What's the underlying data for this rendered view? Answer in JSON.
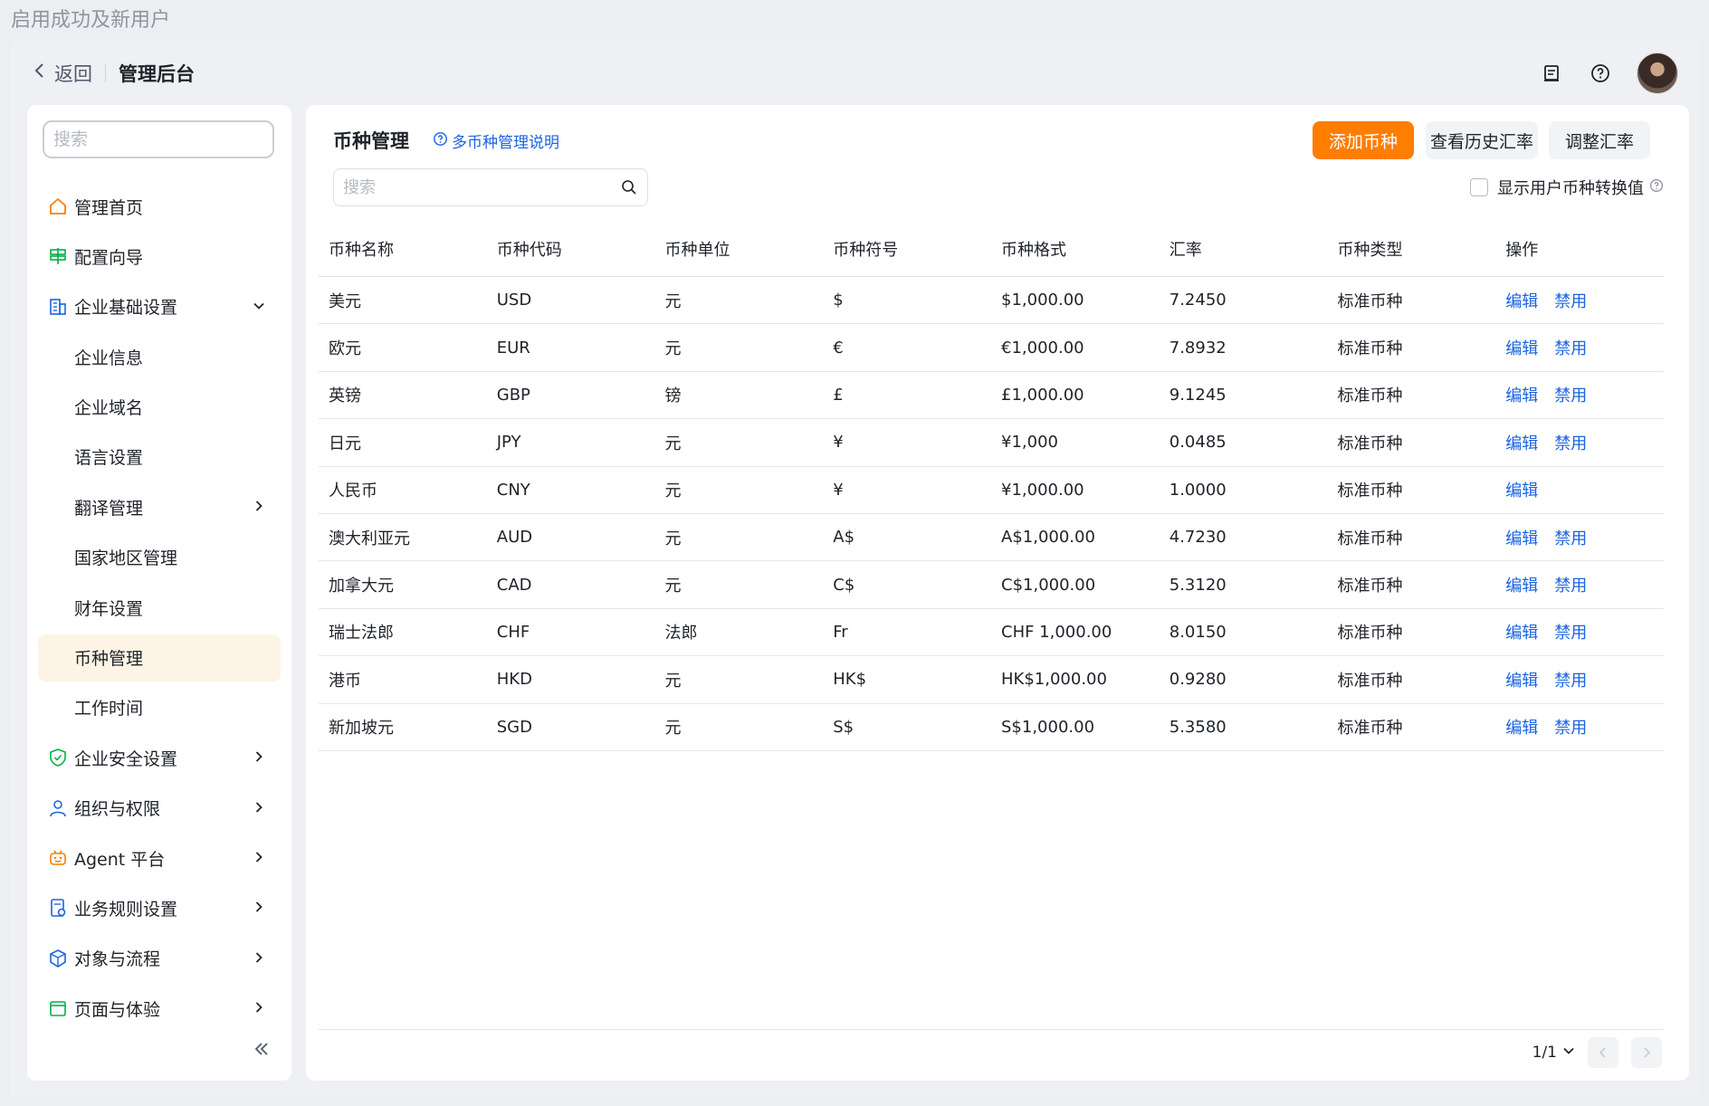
{
  "window": {
    "toast": "启用成功及新用户"
  },
  "header": {
    "back_label": "返回",
    "title": "管理后台",
    "icons": [
      "document-icon",
      "help-circle-icon",
      "avatar"
    ]
  },
  "sidebar": {
    "search_placeholder": "搜索",
    "items": [
      {
        "label": "管理首页",
        "icon": "home-icon",
        "level": 1,
        "arrow": ""
      },
      {
        "label": "配置向导",
        "icon": "signpost-icon",
        "level": 1,
        "arrow": ""
      },
      {
        "label": "企业基础设置",
        "icon": "building-icon",
        "level": 1,
        "arrow": "down"
      },
      {
        "label": "企业信息",
        "level": 2,
        "arrow": ""
      },
      {
        "label": "企业域名",
        "level": 2,
        "arrow": ""
      },
      {
        "label": "语言设置",
        "level": 2,
        "arrow": ""
      },
      {
        "label": "翻译管理",
        "level": 2,
        "arrow": "right"
      },
      {
        "label": "国家地区管理",
        "level": 2,
        "arrow": ""
      },
      {
        "label": "财年设置",
        "level": 2,
        "arrow": ""
      },
      {
        "label": "币种管理",
        "level": 2,
        "arrow": "",
        "active": true
      },
      {
        "label": "工作时间",
        "level": 2,
        "arrow": ""
      },
      {
        "label": "企业安全设置",
        "icon": "shield-icon",
        "level": 1,
        "arrow": "right"
      },
      {
        "label": "组织与权限",
        "icon": "user-icon",
        "level": 1,
        "arrow": "right"
      },
      {
        "label": "Agent 平台",
        "icon": "robot-icon",
        "level": 1,
        "arrow": "right"
      },
      {
        "label": "业务规则设置",
        "icon": "rules-icon",
        "level": 1,
        "arrow": "right"
      },
      {
        "label": "对象与流程",
        "icon": "cube-icon",
        "level": 1,
        "arrow": "right"
      },
      {
        "label": "页面与体验",
        "icon": "window-icon",
        "level": 1,
        "arrow": "right"
      }
    ]
  },
  "main": {
    "title": "币种管理",
    "help_link": "多币种管理说明",
    "buttons": {
      "add": "添加币种",
      "history": "查看历史汇率",
      "adjust": "调整汇率"
    },
    "search_placeholder": "搜索",
    "show_conversion_label": "显示用户币种转换值",
    "columns": [
      "币种名称",
      "币种代码",
      "币种单位",
      "币种符号",
      "币种格式",
      "汇率",
      "币种类型",
      "操作"
    ],
    "edit_label": "编辑",
    "disable_label": "禁用",
    "rows": [
      {
        "name": "美元",
        "code": "USD",
        "unit": "元",
        "symbol": "$",
        "format": "$1,000.00",
        "rate": "7.2450",
        "type": "标准币种",
        "can_disable": true
      },
      {
        "name": "欧元",
        "code": "EUR",
        "unit": "元",
        "symbol": "€",
        "format": "€1,000.00",
        "rate": "7.8932",
        "type": "标准币种",
        "can_disable": true
      },
      {
        "name": "英镑",
        "code": "GBP",
        "unit": "镑",
        "symbol": "£",
        "format": "£1,000.00",
        "rate": "9.1245",
        "type": "标准币种",
        "can_disable": true
      },
      {
        "name": "日元",
        "code": "JPY",
        "unit": "元",
        "symbol": "¥",
        "format": "¥1,000",
        "rate": "0.0485",
        "type": "标准币种",
        "can_disable": true
      },
      {
        "name": "人民币",
        "code": "CNY",
        "unit": "元",
        "symbol": "¥",
        "format": "¥1,000.00",
        "rate": "1.0000",
        "type": "标准币种",
        "can_disable": false
      },
      {
        "name": "澳大利亚元",
        "code": "AUD",
        "unit": "元",
        "symbol": "A$",
        "format": "A$1,000.00",
        "rate": "4.7230",
        "type": "标准币种",
        "can_disable": true
      },
      {
        "name": "加拿大元",
        "code": "CAD",
        "unit": "元",
        "symbol": "C$",
        "format": "C$1,000.00",
        "rate": "5.3120",
        "type": "标准币种",
        "can_disable": true
      },
      {
        "name": "瑞士法郎",
        "code": "CHF",
        "unit": "法郎",
        "symbol": "Fr",
        "format": "CHF 1,000.00",
        "rate": "8.0150",
        "type": "标准币种",
        "can_disable": true
      },
      {
        "name": "港币",
        "code": "HKD",
        "unit": "元",
        "symbol": "HK$",
        "format": "HK$1,000.00",
        "rate": "0.9280",
        "type": "标准币种",
        "can_disable": true
      },
      {
        "name": "新加坡元",
        "code": "SGD",
        "unit": "元",
        "symbol": "S$",
        "format": "S$1,000.00",
        "rate": "5.3580",
        "type": "标准币种",
        "can_disable": true
      }
    ],
    "pagination": {
      "page_info": "1/1"
    }
  },
  "colors": {
    "accent": "#ff7d00",
    "link": "#1b64e0",
    "active_bg": "#fdf4e6"
  }
}
